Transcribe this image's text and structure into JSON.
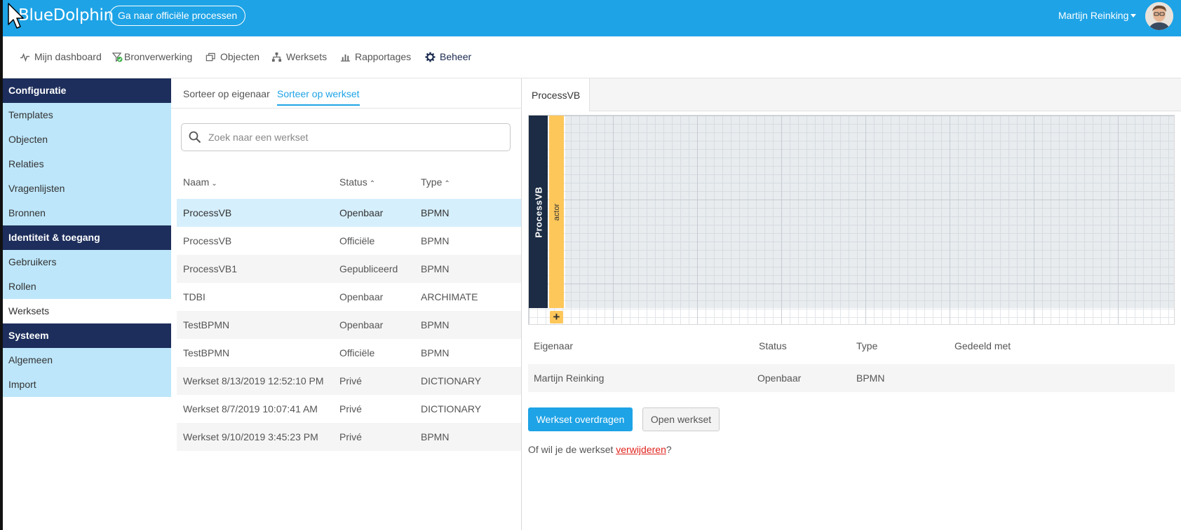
{
  "header": {
    "brand": "BlueDolphin",
    "official_button": "Ga naar officiële processen",
    "user_name": "Martijn Reinking"
  },
  "nav": {
    "items": [
      {
        "label": "Mijn dashboard",
        "icon": "pulse-icon"
      },
      {
        "label": "Bronverwerking",
        "icon": "filter-check-icon"
      },
      {
        "label": "Objecten",
        "icon": "objects-icon"
      },
      {
        "label": "Werksets",
        "icon": "hierarchy-icon"
      },
      {
        "label": "Rapportages",
        "icon": "bar-chart-icon"
      },
      {
        "label": "Beheer",
        "icon": "gear-icon"
      }
    ]
  },
  "sidebar": {
    "sections": [
      {
        "title": "Configuratie",
        "items": [
          "Templates",
          "Objecten",
          "Relaties",
          "Vragenlijsten",
          "Bronnen"
        ]
      },
      {
        "title": "Identiteit & toegang",
        "items": [
          "Gebruikers",
          "Rollen",
          "Werksets"
        ]
      },
      {
        "title": "Systeem",
        "items": [
          "Algemeen",
          "Import"
        ]
      }
    ]
  },
  "list": {
    "sort_tabs": [
      "Sorteer op eigenaar",
      "Sorteer op werkset"
    ],
    "search_placeholder": "Zoek naar een werkset",
    "columns": {
      "name": "Naam",
      "status": "Status",
      "type": "Type"
    },
    "rows": [
      {
        "name": "ProcessVB",
        "status": "Openbaar",
        "type": "BPMN"
      },
      {
        "name": "ProcessVB",
        "status": "Officiële",
        "type": "BPMN"
      },
      {
        "name": "ProcessVB1",
        "status": "Gepubliceerd",
        "type": "BPMN"
      },
      {
        "name": "TDBI",
        "status": "Openbaar",
        "type": "ARCHIMATE"
      },
      {
        "name": "TestBPMN",
        "status": "Openbaar",
        "type": "BPMN"
      },
      {
        "name": "TestBPMN",
        "status": "Officiële",
        "type": "BPMN"
      },
      {
        "name": "Werkset 8/13/2019 12:52:10 PM",
        "status": "Privé",
        "type": "DICTIONARY"
      },
      {
        "name": "Werkset 8/7/2019 10:07:41 AM",
        "status": "Privé",
        "type": "DICTIONARY"
      },
      {
        "name": "Werkset 9/10/2019 3:45:23 PM",
        "status": "Privé",
        "type": "BPMN"
      }
    ]
  },
  "detail": {
    "tab": "ProcessVB",
    "pool_label": "ProcessVB",
    "lane_label": "actor",
    "add_label": "+",
    "columns": {
      "owner": "Eigenaar",
      "status": "Status",
      "type": "Type",
      "shared": "Gedeeld met"
    },
    "row": {
      "owner": "Martijn Reinking",
      "status": "Openbaar",
      "type": "BPMN",
      "shared": ""
    },
    "transfer_button": "Werkset overdragen",
    "open_button": "Open werkset",
    "delete_prefix": "Of wil je de werkset ",
    "delete_link": "verwijderen",
    "delete_suffix": "?"
  },
  "colors": {
    "primary": "#1ea3e6",
    "sidebar_head": "#1d2e5c",
    "sidebar_item": "#bde6fa",
    "lane": "#fdc75a",
    "pool": "#1b2c44",
    "danger": "#e0231c"
  }
}
